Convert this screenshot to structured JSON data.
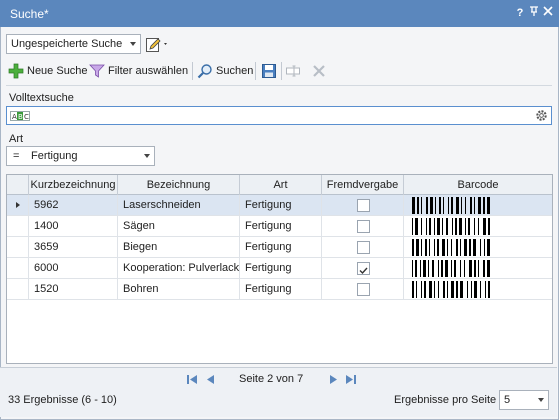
{
  "window": {
    "title": "Suche*",
    "help_label": "?",
    "pin_label": "⊤",
    "close_label": "✕"
  },
  "saved_search": {
    "value": "Ungespeicherte Suche"
  },
  "toolbar": {
    "new_search_label": "Neue Suche",
    "filter_label": "Filter auswählen",
    "search_label": "Suchen"
  },
  "fulltext": {
    "label": "Volltextsuche",
    "value": ""
  },
  "art_filter": {
    "label": "Art",
    "operator": "=",
    "value": "Fertigung"
  },
  "grid": {
    "columns": [
      "Kurzbezeichnung",
      "Bezeichnung",
      "Art",
      "Fremdvergabe",
      "Barcode"
    ],
    "rows": [
      {
        "kurz": "5962",
        "bez": "Laserschneiden",
        "art": "Fertigung",
        "fremd": false,
        "selected": true
      },
      {
        "kurz": "1400",
        "bez": "Sägen",
        "art": "Fertigung",
        "fremd": false,
        "selected": false
      },
      {
        "kurz": "3659",
        "bez": "Biegen",
        "art": "Fertigung",
        "fremd": false,
        "selected": false
      },
      {
        "kurz": "6000",
        "bez": "Kooperation: Pulverlack",
        "art": "Fertigung",
        "fremd": true,
        "selected": false
      },
      {
        "kurz": "1520",
        "bez": "Bohren",
        "art": "Fertigung",
        "fremd": false,
        "selected": false
      }
    ]
  },
  "pagination": {
    "page_text": "Seite 2 von 7",
    "results_text": "33 Ergebnisse (6 - 10)",
    "per_page_label": "Ergebnisse pro Seite",
    "per_page_value": "5"
  },
  "colors": {
    "titlebar": "#5b87bd",
    "selection": "#dbe5f2",
    "accent": "#5a8fcf"
  }
}
